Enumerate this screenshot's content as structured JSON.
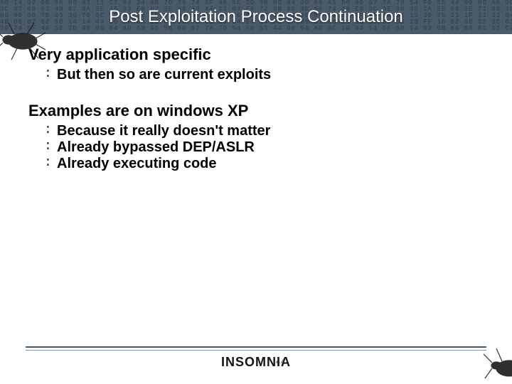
{
  "title": "Post Exploitation Process Continuation",
  "points": {
    "p1": "Very application specific",
    "p1_subs": [
      "But then so are current exploits"
    ],
    "p2": "Examples are on windows XP",
    "p2_subs": [
      "Because it really doesn't matter",
      "Already bypassed DEP/ASLR",
      "Already executing code"
    ]
  },
  "footer": {
    "brand": "INSOMNIA",
    "page": "44"
  },
  "colors": {
    "header_bg": "#4a5a6a",
    "title_fg": "#ffffff"
  },
  "hex_rows": [
    "50 14 02 0B 86 00 01 11 C7 04 34 0B 7D 79 74 5F 48 5E 2D 90 00 04 6D 69 A5 56 00 67 7A 70 54 F0 55 44 00 00 A0 9C 10 64 14 0F",
    "3C 97 68 61 48 67 0A 5F 4B 59 E8 02 3E 58 A3 4A 21 03 E6 72 9B 55 4E 66 74 48 E9 9C 3E 58 45 2A 55 68 5E 71 00 10 3C 4F 77 53",
    "00 00 08 7B 09 30 70 6E 1D 36 0B 59 EB 06 37 17 08 50 82 67 4B FC 20 09 09 51 0F 7F 76 31 15 30 25 13 1F 31 33 64 58 53 00 95",
    "4B 00 02 82 50 14 14 44 80 FF 6A 20 0A 00 A6 62 00 04 E4 14 D0 0F 80 01 00 15 18 00 00 5D 13 FF 16 02 0B 22 3C 03 4F 01 50 82",
    "79 74 5F 48 5E 2D 90 00 04 6D 69 A5 56 00 67 7A 70 54 F0 55 44 00 00 A0 9C 10 64 14 0F 50 14 02 0B 86 00 01 11 C7 04 34 0B 7D"
  ]
}
